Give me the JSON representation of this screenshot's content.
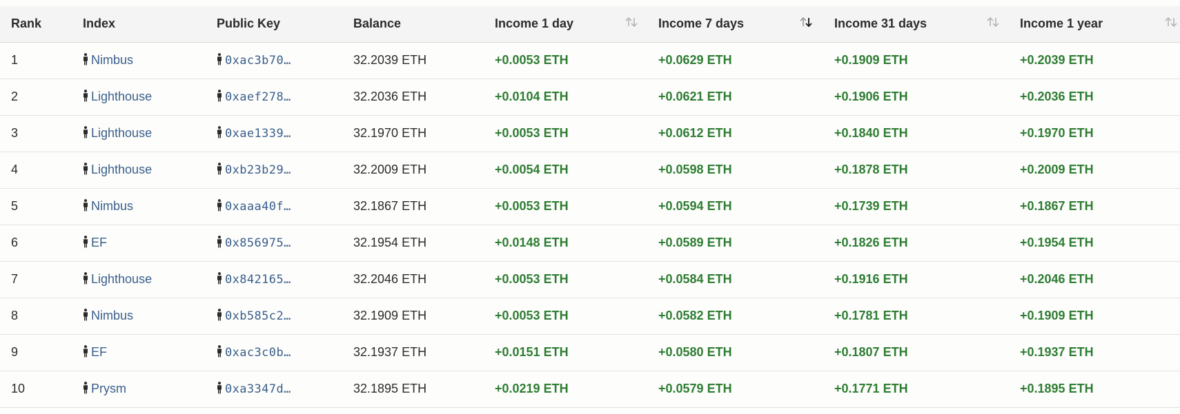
{
  "table": {
    "headers": {
      "rank": "Rank",
      "index": "Index",
      "pubkey": "Public Key",
      "balance": "Balance",
      "income_1d": "Income 1 day",
      "income_7d": "Income 7 days",
      "income_31d": "Income 31 days",
      "income_1y": "Income 1 year"
    },
    "active_sort": "income_7d",
    "icons": {
      "validator": "person-icon",
      "sort": "sort-arrows-icon"
    },
    "colors": {
      "income_positive": "#2e7d32",
      "link": "#3a5f8a"
    },
    "rows": [
      {
        "rank": "1",
        "index": "Nimbus",
        "pubkey": "0xac3b70…",
        "balance": "32.2039 ETH",
        "income_1d": "+0.0053 ETH",
        "income_7d": "+0.0629 ETH",
        "income_31d": "+0.1909 ETH",
        "income_1y": "+0.2039 ETH"
      },
      {
        "rank": "2",
        "index": "Lighthouse",
        "pubkey": "0xaef278…",
        "balance": "32.2036 ETH",
        "income_1d": "+0.0104 ETH",
        "income_7d": "+0.0621 ETH",
        "income_31d": "+0.1906 ETH",
        "income_1y": "+0.2036 ETH"
      },
      {
        "rank": "3",
        "index": "Lighthouse",
        "pubkey": "0xae1339…",
        "balance": "32.1970 ETH",
        "income_1d": "+0.0053 ETH",
        "income_7d": "+0.0612 ETH",
        "income_31d": "+0.1840 ETH",
        "income_1y": "+0.1970 ETH"
      },
      {
        "rank": "4",
        "index": "Lighthouse",
        "pubkey": "0xb23b29…",
        "balance": "32.2009 ETH",
        "income_1d": "+0.0054 ETH",
        "income_7d": "+0.0598 ETH",
        "income_31d": "+0.1878 ETH",
        "income_1y": "+0.2009 ETH"
      },
      {
        "rank": "5",
        "index": "Nimbus",
        "pubkey": "0xaaa40f…",
        "balance": "32.1867 ETH",
        "income_1d": "+0.0053 ETH",
        "income_7d": "+0.0594 ETH",
        "income_31d": "+0.1739 ETH",
        "income_1y": "+0.1867 ETH"
      },
      {
        "rank": "6",
        "index": "EF",
        "pubkey": "0x856975…",
        "balance": "32.1954 ETH",
        "income_1d": "+0.0148 ETH",
        "income_7d": "+0.0589 ETH",
        "income_31d": "+0.1826 ETH",
        "income_1y": "+0.1954 ETH"
      },
      {
        "rank": "7",
        "index": "Lighthouse",
        "pubkey": "0x842165…",
        "balance": "32.2046 ETH",
        "income_1d": "+0.0053 ETH",
        "income_7d": "+0.0584 ETH",
        "income_31d": "+0.1916 ETH",
        "income_1y": "+0.2046 ETH"
      },
      {
        "rank": "8",
        "index": "Nimbus",
        "pubkey": "0xb585c2…",
        "balance": "32.1909 ETH",
        "income_1d": "+0.0053 ETH",
        "income_7d": "+0.0582 ETH",
        "income_31d": "+0.1781 ETH",
        "income_1y": "+0.1909 ETH"
      },
      {
        "rank": "9",
        "index": "EF",
        "pubkey": "0xac3c0b…",
        "balance": "32.1937 ETH",
        "income_1d": "+0.0151 ETH",
        "income_7d": "+0.0580 ETH",
        "income_31d": "+0.1807 ETH",
        "income_1y": "+0.1937 ETH"
      },
      {
        "rank": "10",
        "index": "Prysm",
        "pubkey": "0xa3347d…",
        "balance": "32.1895 ETH",
        "income_1d": "+0.0219 ETH",
        "income_7d": "+0.0579 ETH",
        "income_31d": "+0.1771 ETH",
        "income_1y": "+0.1895 ETH"
      }
    ]
  }
}
